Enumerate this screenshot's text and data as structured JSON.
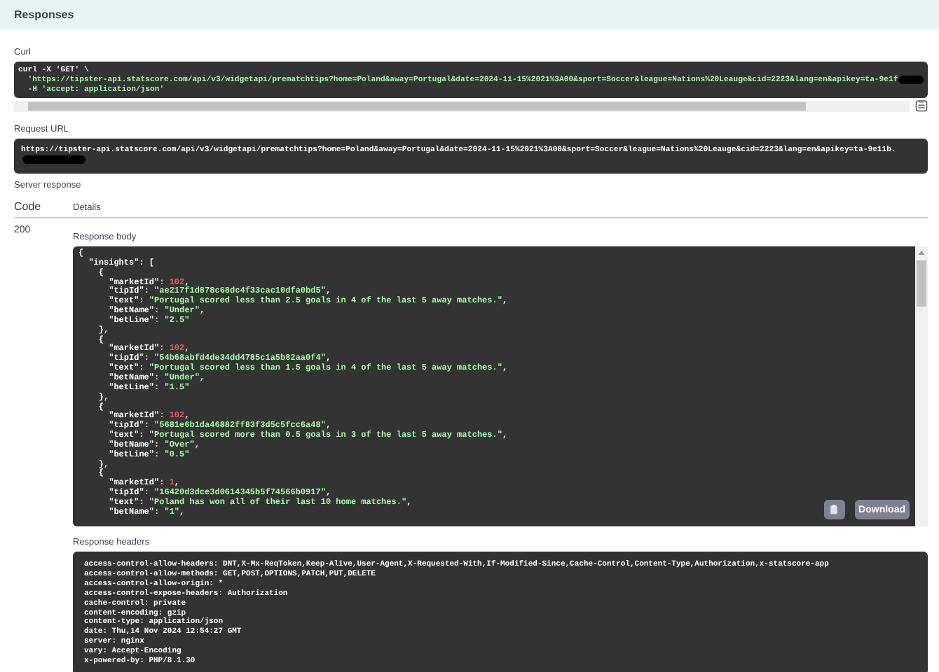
{
  "section_title": "Responses",
  "curl": {
    "label": "Curl",
    "lines": [
      "curl -X 'GET' \\",
      "  'https://tipster-api.statscore.com/api/v3/widgetapi/prematchtips?home=Poland&away=Portugal&date=2024-11-15%2021%3A00&sport=Soccer&league=Nations%20Leauge&cid=2223&lang=en&apikey=ta-9e1f",
      "  -H 'accept: application/json'"
    ]
  },
  "request_url": {
    "label": "Request URL",
    "value": "https://tipster-api.statscore.com/api/v3/widgetapi/prematchtips?home=Poland&away=Portugal&date=2024-11-15%2021%3A00&sport=Soccer&league=Nations%20Leauge&cid=2223&lang=en&apikey=ta-9e11b."
  },
  "server_response": {
    "label": "Server response",
    "columns": [
      "Code",
      "Details"
    ],
    "code": "200",
    "body_label": "Response body",
    "body_lines": [
      [
        {
          "kind": "punct",
          "text": "{"
        }
      ],
      [
        {
          "kind": "key",
          "text": "  \"insights\""
        },
        {
          "kind": "punct",
          "text": ": ["
        }
      ],
      [
        {
          "kind": "punct",
          "text": "    {"
        }
      ],
      [
        {
          "kind": "key",
          "text": "      \"marketId\""
        },
        {
          "kind": "punct",
          "text": ": "
        },
        {
          "kind": "number",
          "text": "102"
        },
        {
          "kind": "punct",
          "text": ","
        }
      ],
      [
        {
          "kind": "key",
          "text": "      \"tipId\""
        },
        {
          "kind": "punct",
          "text": ": "
        },
        {
          "kind": "string",
          "text": "\"ae217f1d878c68dc4f33cac10dfa0bd5\""
        },
        {
          "kind": "punct",
          "text": ","
        }
      ],
      [
        {
          "kind": "key",
          "text": "      \"text\""
        },
        {
          "kind": "punct",
          "text": ": "
        },
        {
          "kind": "string",
          "text": "\"Portugal scored less than 2.5 goals in 4 of the last 5 away matches.\""
        },
        {
          "kind": "punct",
          "text": ","
        }
      ],
      [
        {
          "kind": "key",
          "text": "      \"betName\""
        },
        {
          "kind": "punct",
          "text": ": "
        },
        {
          "kind": "string",
          "text": "\"Under\""
        },
        {
          "kind": "punct",
          "text": ","
        }
      ],
      [
        {
          "kind": "key",
          "text": "      \"betLine\""
        },
        {
          "kind": "punct",
          "text": ": "
        },
        {
          "kind": "string",
          "text": "\"2.5\""
        }
      ],
      [
        {
          "kind": "punct",
          "text": "    },"
        }
      ],
      [
        {
          "kind": "punct",
          "text": "    {"
        }
      ],
      [
        {
          "kind": "key",
          "text": "      \"marketId\""
        },
        {
          "kind": "punct",
          "text": ": "
        },
        {
          "kind": "number",
          "text": "102"
        },
        {
          "kind": "punct",
          "text": ","
        }
      ],
      [
        {
          "kind": "key",
          "text": "      \"tipId\""
        },
        {
          "kind": "punct",
          "text": ": "
        },
        {
          "kind": "string",
          "text": "\"54b68abfd4de34dd4785c1a5b82aa0f4\""
        },
        {
          "kind": "punct",
          "text": ","
        }
      ],
      [
        {
          "kind": "key",
          "text": "      \"text\""
        },
        {
          "kind": "punct",
          "text": ": "
        },
        {
          "kind": "string",
          "text": "\"Portugal scored less than 1.5 goals in 4 of the last 5 away matches.\""
        },
        {
          "kind": "punct",
          "text": ","
        }
      ],
      [
        {
          "kind": "key",
          "text": "      \"betName\""
        },
        {
          "kind": "punct",
          "text": ": "
        },
        {
          "kind": "string",
          "text": "\"Under\""
        },
        {
          "kind": "punct",
          "text": ","
        }
      ],
      [
        {
          "kind": "key",
          "text": "      \"betLine\""
        },
        {
          "kind": "punct",
          "text": ": "
        },
        {
          "kind": "string",
          "text": "\"1.5\""
        }
      ],
      [
        {
          "kind": "punct",
          "text": "    },"
        }
      ],
      [
        {
          "kind": "punct",
          "text": "    {"
        }
      ],
      [
        {
          "kind": "key",
          "text": "      \"marketId\""
        },
        {
          "kind": "punct",
          "text": ": "
        },
        {
          "kind": "number",
          "text": "102"
        },
        {
          "kind": "punct",
          "text": ","
        }
      ],
      [
        {
          "kind": "key",
          "text": "      \"tipId\""
        },
        {
          "kind": "punct",
          "text": ": "
        },
        {
          "kind": "string",
          "text": "\"5681e6b1da46882ff83f3d5c5fcc6a48\""
        },
        {
          "kind": "punct",
          "text": ","
        }
      ],
      [
        {
          "kind": "key",
          "text": "      \"text\""
        },
        {
          "kind": "punct",
          "text": ": "
        },
        {
          "kind": "string",
          "text": "\"Portugal scored more than 0.5 goals in 3 of the last 5 away matches.\""
        },
        {
          "kind": "punct",
          "text": ","
        }
      ],
      [
        {
          "kind": "key",
          "text": "      \"betName\""
        },
        {
          "kind": "punct",
          "text": ": "
        },
        {
          "kind": "string",
          "text": "\"Over\""
        },
        {
          "kind": "punct",
          "text": ","
        }
      ],
      [
        {
          "kind": "key",
          "text": "      \"betLine\""
        },
        {
          "kind": "punct",
          "text": ": "
        },
        {
          "kind": "string",
          "text": "\"0.5\""
        }
      ],
      [
        {
          "kind": "punct",
          "text": "    },"
        }
      ],
      [
        {
          "kind": "punct",
          "text": "    {"
        }
      ],
      [
        {
          "kind": "key",
          "text": "      \"marketId\""
        },
        {
          "kind": "punct",
          "text": ": "
        },
        {
          "kind": "number",
          "text": "1"
        },
        {
          "kind": "punct",
          "text": ","
        }
      ],
      [
        {
          "kind": "key",
          "text": "      \"tipId\""
        },
        {
          "kind": "punct",
          "text": ": "
        },
        {
          "kind": "string",
          "text": "\"16420d3dce3d0614345b5f74566b0917\""
        },
        {
          "kind": "punct",
          "text": ","
        }
      ],
      [
        {
          "kind": "key",
          "text": "      \"text\""
        },
        {
          "kind": "punct",
          "text": ": "
        },
        {
          "kind": "string",
          "text": "\"Poland has won all of their last 10 home matches.\""
        },
        {
          "kind": "punct",
          "text": ","
        }
      ],
      [
        {
          "kind": "key",
          "text": "      \"betName\""
        },
        {
          "kind": "punct",
          "text": ": "
        },
        {
          "kind": "string",
          "text": "\"1\""
        },
        {
          "kind": "punct",
          "text": ","
        }
      ]
    ],
    "download_button": "Download",
    "headers_label": "Response headers",
    "header_lines": [
      "access-control-allow-headers: DNT,X-Mx-ReqToken,Keep-Alive,User-Agent,X-Requested-With,If-Modified-Since,Cache-Control,Content-Type,Authorization,x-statscore-app",
      "access-control-allow-methods: GET,POST,OPTIONS,PATCH,PUT,DELETE",
      "access-control-allow-origin: *",
      "access-control-expose-headers: Authorization",
      "cache-control: private",
      "content-encoding: gzip",
      "content-type: application/json",
      "date: Thu,14 Nov 2024 12:54:27 GMT",
      "server: nginx",
      "vary: Accept-Encoding",
      "x-powered-by: PHP/8.1.30"
    ]
  }
}
